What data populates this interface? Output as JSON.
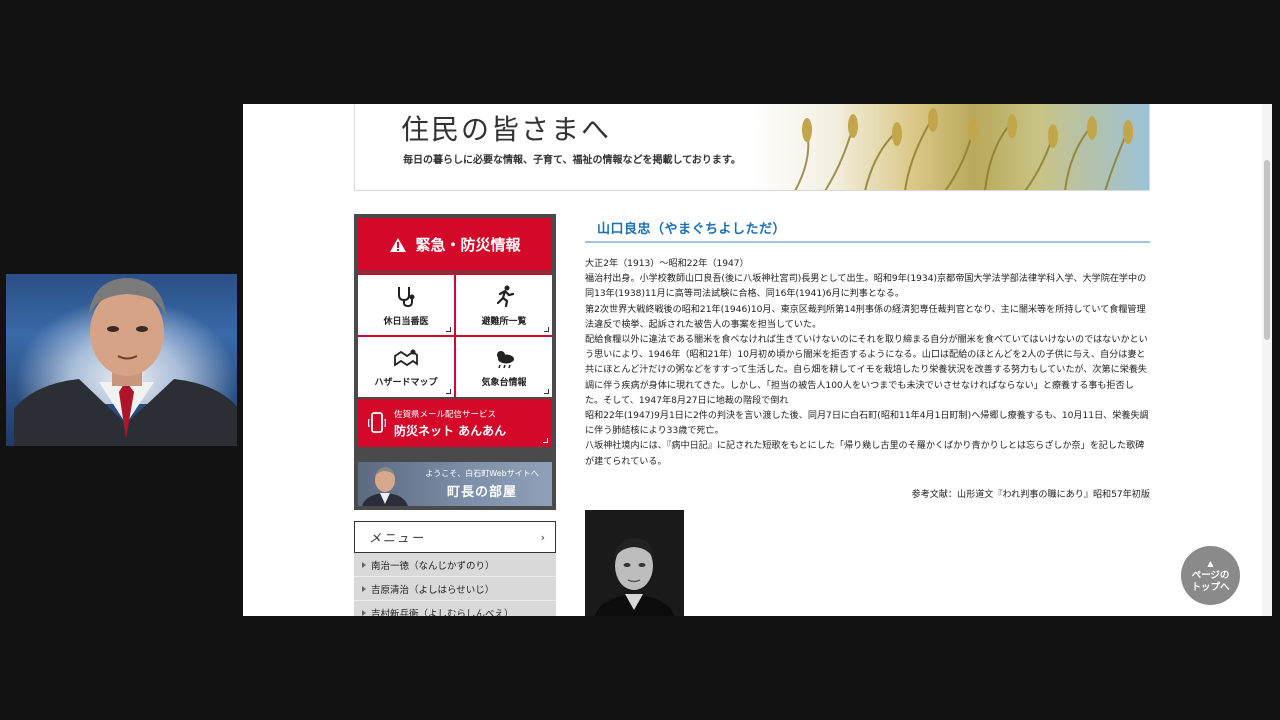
{
  "banner": {
    "title": "住民の皆さまへ",
    "subtitle": "毎日の暮らしに必要な情報、子育て、福祉の情報などを掲載しております。"
  },
  "disaster_panel": {
    "header": "緊急・防災情報",
    "tiles": [
      {
        "label": "休日当番医",
        "icon": "stethoscope-icon"
      },
      {
        "label": "避難所一覧",
        "icon": "running-person-icon"
      },
      {
        "label": "ハザードマップ",
        "icon": "map-icon"
      },
      {
        "label": "気象台情報",
        "icon": "weather-icon"
      }
    ],
    "mail": {
      "line1": "佐賀県メール配信サービス",
      "line2": "防災ネット あんあん",
      "icon": "mobile-phone-icon"
    },
    "mayor": {
      "line1": "ようこそ、白石町Webサイトへ",
      "line2": "町長の部屋"
    }
  },
  "menu": {
    "header": "メニュー",
    "arrow": "›",
    "items": [
      "南治一徳（なんじかずのり）",
      "吉原清治（よしはらせいじ）",
      "吉村新兵衛（よしむらしんべえ）"
    ]
  },
  "article": {
    "title": "山口良忠（やまぐちよしただ）",
    "paragraphs": [
      "大正2年（1913）～昭和22年（1947）",
      "福治村出身。小学校教師山口良吾(後に八坂神社宮司)長男として出生。昭和9年(1934)京都帝国大学法学部法律学科入学、大学院在学中の同13年(1938)11月に高等司法試験に合格、同16年(1941)6月に判事となる。",
      "第2次世界大戦終戦後の昭和21年(1946)10月、東京区裁判所第14刑事係の経済犯専任裁判官となり、主に闇米等を所持していて食糧管理法違反で検挙、起訴された被告人の事案を担当していた。",
      "配給食糧以外に違法である闇米を食べなければ生きていけないのにそれを取り締まる自分が闇米を食べていてはいけないのではないかという思いにより、1946年（昭和21年）10月初め頃から闇米を拒否するようになる。山口は配給のほとんどを2人の子供に与え、自分は妻と共にほとんど汁だけの粥などをすすって生活した。自ら畑を耕してイモを栽培したり栄養状況を改善する努力もしていたが、次第に栄養失調に伴う疾病が身体に現れてきた。しかし、「担当の被告人100人をいつまでも未決でいさせなければならない」と療養する事も拒否した。そして、1947年8月27日に地裁の階段で倒れ",
      "昭和22年(1947)9月1日に2件の判決を言い渡した後、同月7日に白石町(昭和11年4月1日町制)へ帰郷し療養するも、10月11日、栄養失調に伴う肺結核により33歳で死亡。",
      "八坂神社境内には、『病中日記』に記された短歌をもとにした「帰り幾し古里のそ羅かくばかり青かりしとは忘らざしか奈」を記した歌碑が建てられている。"
    ],
    "reference": "参考文献：山形道文『われ判事の職にあり』昭和57年初版"
  },
  "page_top": {
    "line1": "ページの",
    "line2": "トップへ",
    "arrow": "▲"
  }
}
